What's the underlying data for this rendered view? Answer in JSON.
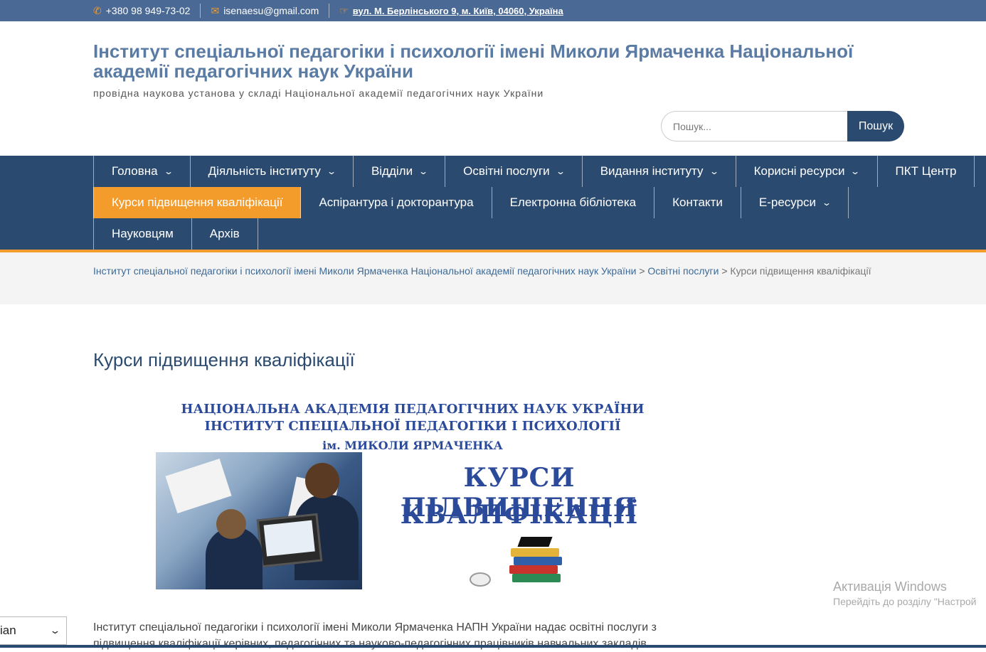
{
  "topbar": {
    "phone": "+380 98 949-73-02",
    "email": "isenaesu@gmail.com",
    "address": "вул. М. Берлінського 9, м. Київ, 04060, Україна"
  },
  "header": {
    "site_title": "Інститут спеціальної педагогіки і психології імені Миколи Ярмаченка Національної академії педагогічних наук України",
    "site_description": "провідна наукова установа у складі Національної академії педагогічних наук України",
    "search_placeholder": "Пошук...",
    "search_button": "Пошук"
  },
  "nav": {
    "row1": [
      {
        "label": "Головна",
        "dropdown": true
      },
      {
        "label": "Діяльність інституту",
        "dropdown": true
      },
      {
        "label": "Відділи",
        "dropdown": true
      },
      {
        "label": "Освітні послуги",
        "dropdown": true
      },
      {
        "label": "Видання інституту",
        "dropdown": true
      },
      {
        "label": "Корисні ресурси",
        "dropdown": true
      },
      {
        "label": "ПКТ Центр",
        "dropdown": false
      }
    ],
    "row2": [
      {
        "label": "Курси підвищення кваліфікації",
        "dropdown": false,
        "active": true
      },
      {
        "label": "Аспірантура і докторантура",
        "dropdown": false
      },
      {
        "label": "Електронна бібліотека",
        "dropdown": false
      },
      {
        "label": "Контакти",
        "dropdown": false
      },
      {
        "label": "Е-ресурси",
        "dropdown": true
      }
    ],
    "row3": [
      {
        "label": "Науковцям",
        "dropdown": false
      },
      {
        "label": "Архів",
        "dropdown": false
      }
    ],
    "chevron": "⌄"
  },
  "breadcrumb": {
    "home": "Інститут спеціальної педагогіки і психології імені Миколи Ярмаченка Національної академії педагогічних наук України",
    "sep": " > ",
    "section": "Освітні послуги",
    "current": "Курси підвищення кваліфікації"
  },
  "main": {
    "page_title": "Курси підвищення кваліфікації",
    "banner": {
      "line1": "НАЦІОНАЛЬНА АКАДЕМІЯ ПЕДАГОГІЧНИХ НАУК УКРАЇНИ",
      "line2": "ІНСТИТУТ СПЕЦІАЛЬНОЇ ПЕДАГОГІКИ І ПСИХОЛОГІЇ",
      "line3": "ім. МИКОЛИ ЯРМАЧЕНКА",
      "big1": "КУРСИ ПІДВИЩЕННЯ",
      "big2": "КВАЛІФІКАЦІЇ"
    },
    "body_text": "Інститут спеціальної педагогіки і психології імені Миколи Ярмаченка НАПН України надає освітні послуги з підвищення кваліфікації керівних, педагогічних та науково-педагогічних працівників навчальних закладів"
  },
  "watermark": {
    "title": "Активація Windows",
    "subtitle": "Перейдіть до розділу \"Настрой"
  },
  "language": {
    "selected": "ian",
    "chevron": "⌄"
  },
  "colors": {
    "topbar": "#4a6a95",
    "nav": "#2b4a6f",
    "accent": "#f39c2b",
    "title": "#5a7ba3"
  }
}
